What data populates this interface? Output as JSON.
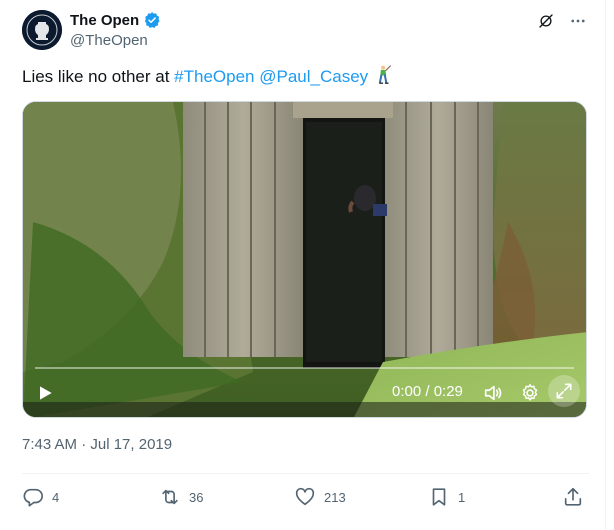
{
  "author": {
    "display_name": "The Open",
    "handle": "@TheOpen",
    "verified": true
  },
  "tweet": {
    "text_plain": "Lies like no other at ",
    "hashtag": "#TheOpen",
    "mention": "@Paul_Casey",
    "emoji": "golfer-emoji",
    "timestamp": "7:43 AM · Jul 17, 2019"
  },
  "video": {
    "time_display": "0:00 / 0:29",
    "progress": 0
  },
  "actions": {
    "replies": "4",
    "reposts": "36",
    "likes": "213",
    "bookmarks": "1"
  },
  "colors": {
    "link": "#1d9bf0",
    "verified": "#1d9bf0",
    "secondary_text": "#536471",
    "primary_text": "#0f1419"
  },
  "icons": [
    "grok-icon",
    "more-icon",
    "play-icon",
    "volume-icon",
    "settings-icon",
    "expand-icon",
    "reply-icon",
    "repost-icon",
    "like-icon",
    "bookmark-icon",
    "share-icon"
  ]
}
